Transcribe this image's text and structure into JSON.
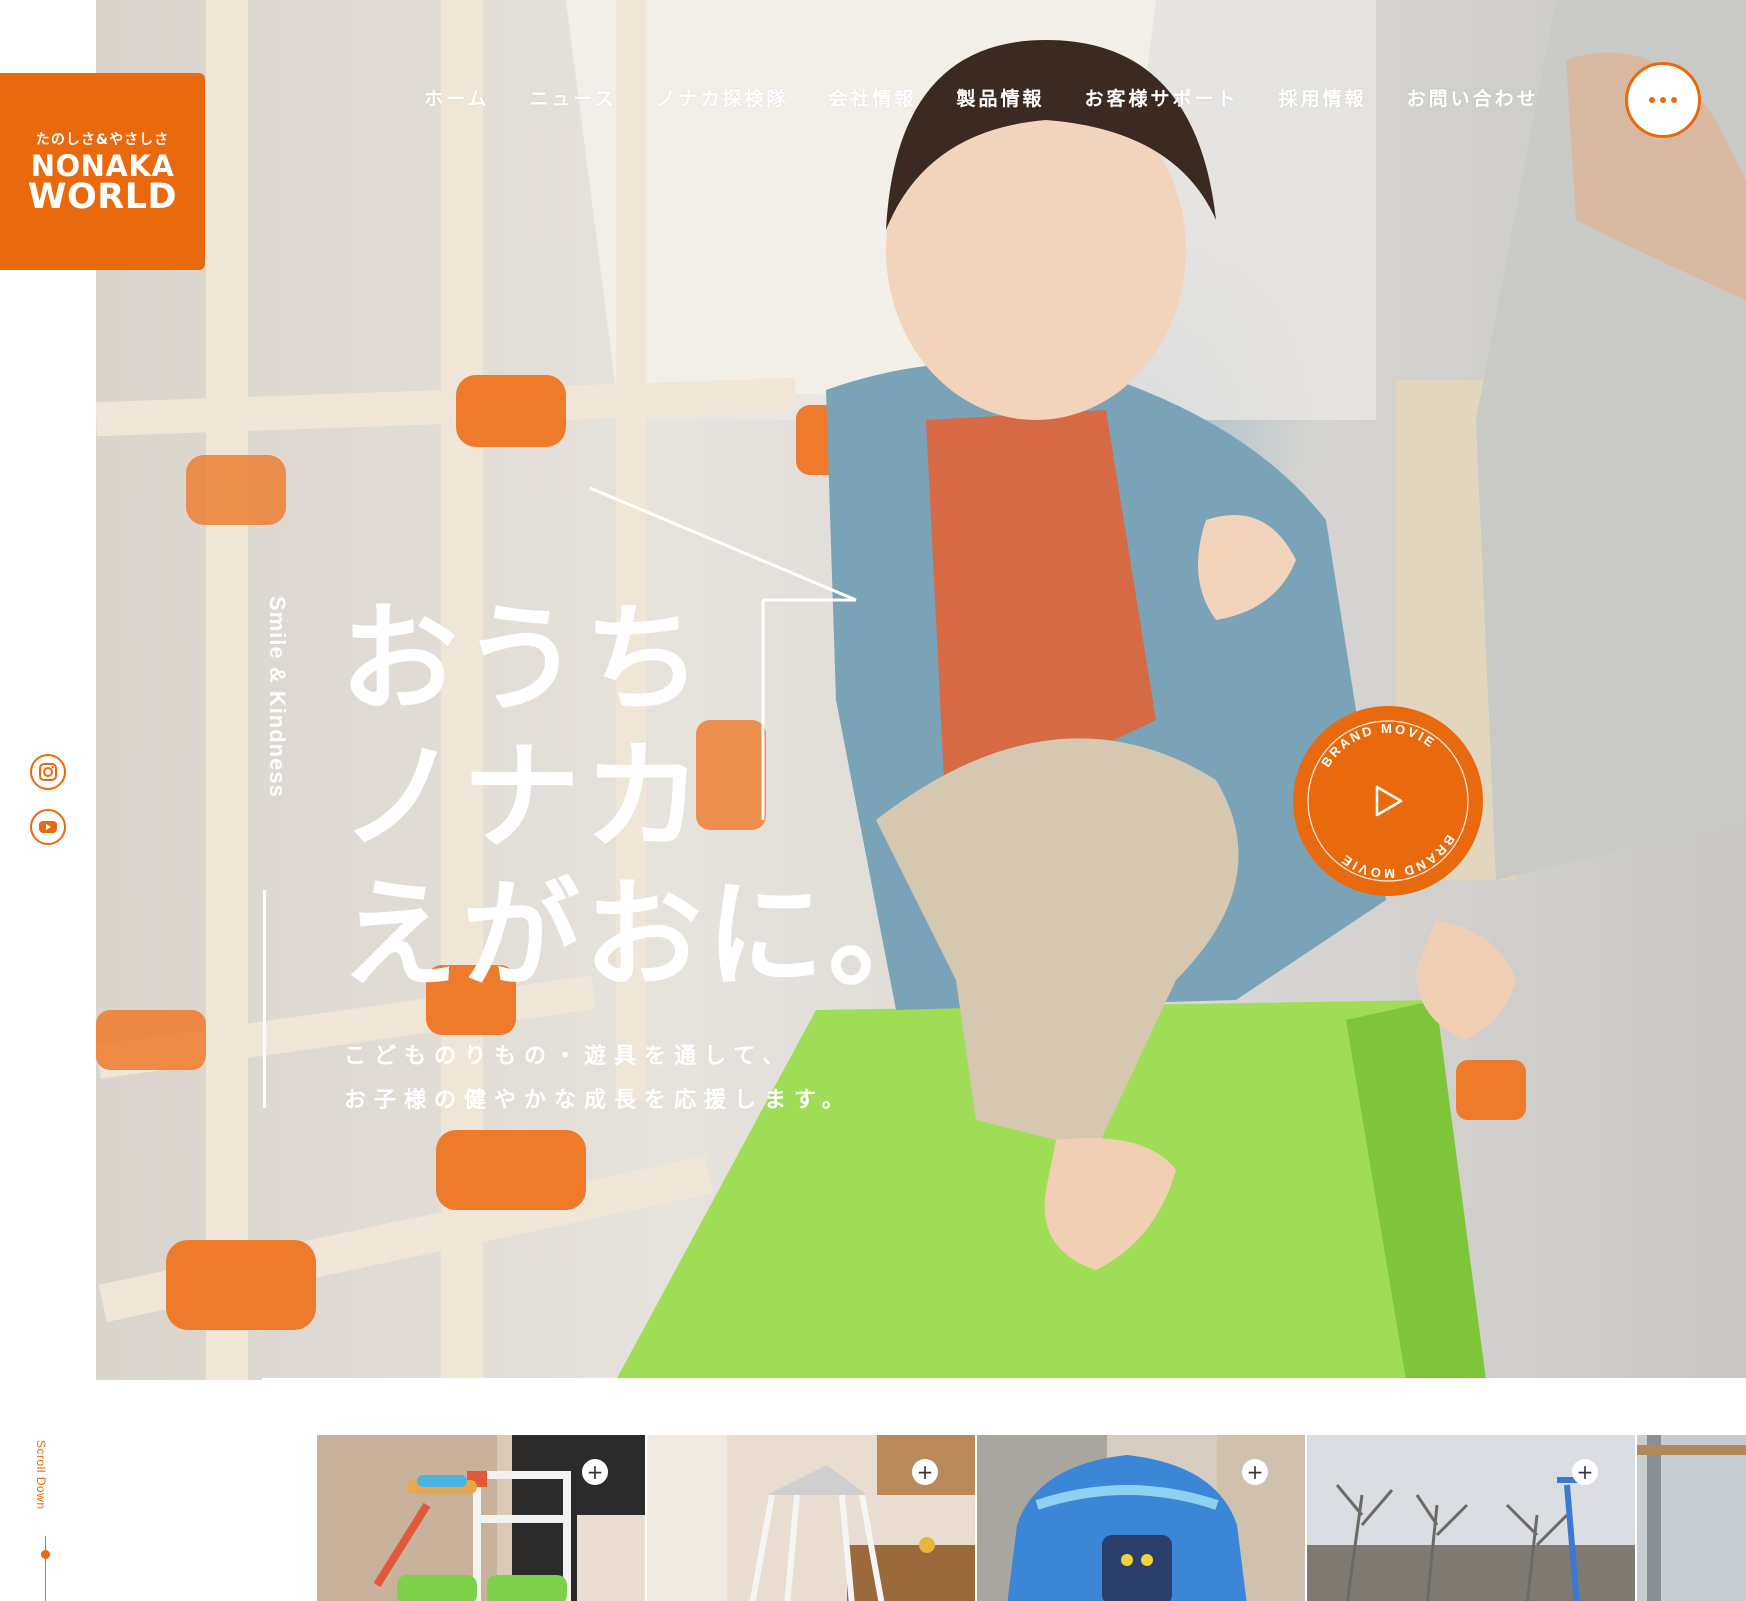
{
  "brand": {
    "tagline": "たのしさ&やさしさ",
    "name_line1": "NONAKA",
    "name_line2": "WORLD",
    "accent_color": "#e96a0e"
  },
  "nav": {
    "items": [
      {
        "label": "ホーム"
      },
      {
        "label": "ニュース"
      },
      {
        "label": "ノナカ探検隊"
      },
      {
        "label": "会社情報"
      },
      {
        "label": "製品情報"
      },
      {
        "label": "お客様サポート"
      },
      {
        "label": "採用情報"
      },
      {
        "label": "お問い合わせ"
      }
    ],
    "menu_icon": "more-dots-icon"
  },
  "hero": {
    "catch_lines": [
      "おうち",
      "ノナカ",
      "えがおに。"
    ],
    "sub_lines": [
      "こどものりもの・遊具を通して、",
      "お子様の健やかな成長を応援します。"
    ],
    "vertical_tagline": "Smile & Kindness",
    "brand_movie_label": "BRAND MOVIE"
  },
  "social": {
    "instagram_icon": "instagram-icon",
    "youtube_icon": "youtube-icon"
  },
  "scroll": {
    "label": "Scroll Down"
  },
  "thumbnails": [
    {
      "name": "thumbnail-jungle-gym",
      "icon": "plus-icon"
    },
    {
      "name": "thumbnail-swing",
      "icon": "plus-icon"
    },
    {
      "name": "thumbnail-play-tent",
      "icon": "plus-icon"
    },
    {
      "name": "thumbnail-outdoor-trees",
      "icon": "plus-icon"
    },
    {
      "name": "thumbnail-partial",
      "icon": ""
    }
  ]
}
